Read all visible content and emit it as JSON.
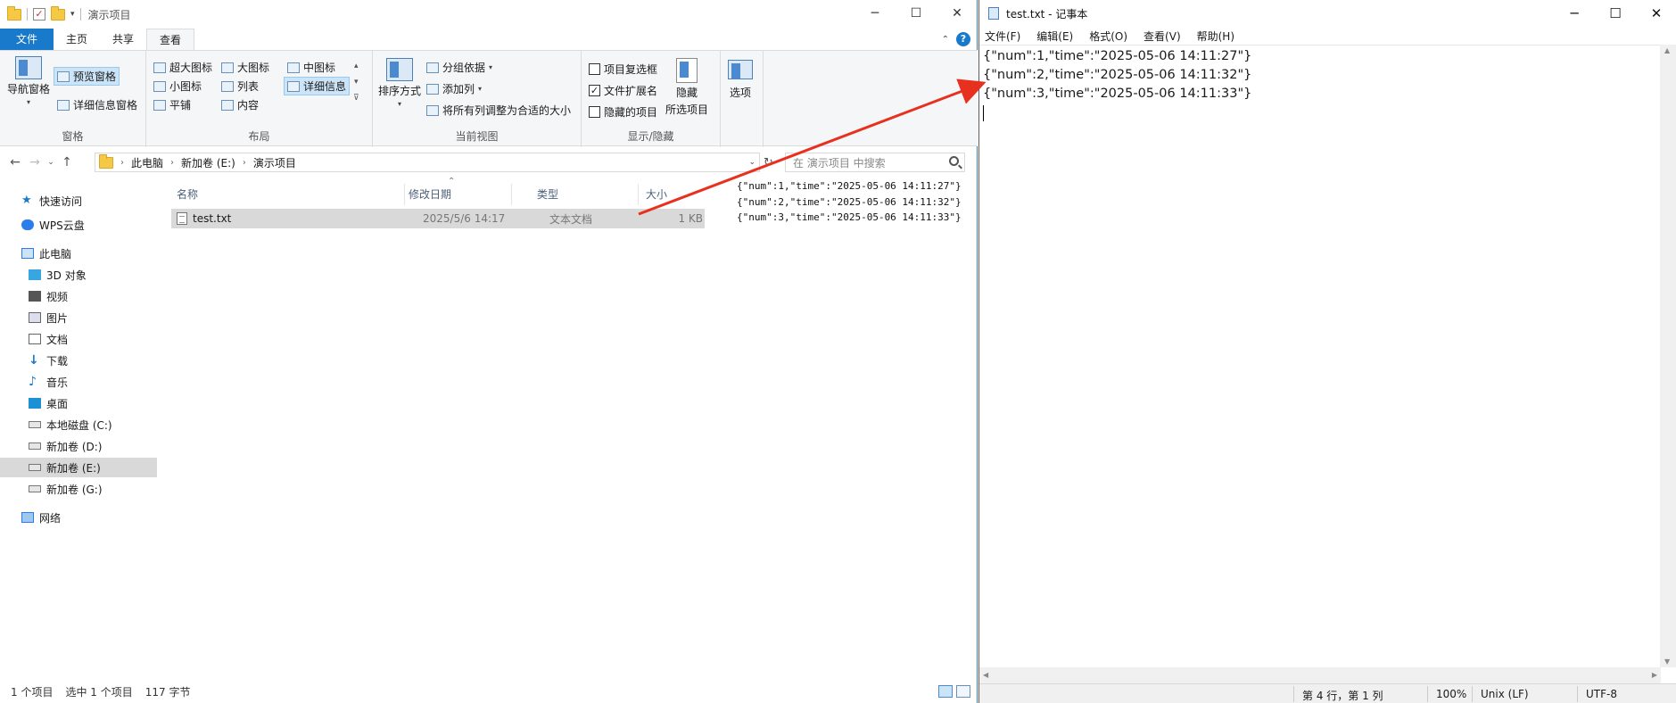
{
  "explorer": {
    "title": "演示项目",
    "tabs": [
      "文件",
      "主页",
      "共享",
      "查看"
    ],
    "active_tab": "查看",
    "ribbon": {
      "panes_group": {
        "nav_pane": "导航窗格",
        "preview_pane": "预览窗格",
        "details_pane": "详细信息窗格",
        "label": "窗格"
      },
      "layout_group": {
        "items": [
          "超大图标",
          "大图标",
          "中图标",
          "小图标",
          "列表",
          "详细信息",
          "平铺",
          "内容"
        ],
        "label": "布局"
      },
      "current_view_group": {
        "sort_by": "排序方式",
        "group_by": "分组依据",
        "add_columns": "添加列",
        "fit_columns": "将所有列调整为合适的大小",
        "label": "当前视图"
      },
      "show_hide_group": {
        "item_checkboxes": "项目复选框",
        "file_extensions": "文件扩展名",
        "hidden_items": "隐藏的项目",
        "hide_selected_1": "隐藏",
        "hide_selected_2": "所选项目",
        "label": "显示/隐藏"
      },
      "options": "选项"
    },
    "address": {
      "segments": [
        "此电脑",
        "新加卷 (E:)",
        "演示项目"
      ],
      "search_placeholder": "在 演示项目 中搜索"
    },
    "nav_pane": {
      "items": [
        "快速访问",
        "WPS云盘",
        "此电脑",
        "3D 对象",
        "视频",
        "图片",
        "文档",
        "下载",
        "音乐",
        "桌面",
        "本地磁盘 (C:)",
        "新加卷 (D:)",
        "新加卷 (E:)",
        "新加卷 (G:)",
        "网络"
      ],
      "selected": "新加卷 (E:)"
    },
    "columns": [
      "名称",
      "修改日期",
      "类型",
      "大小"
    ],
    "files": [
      {
        "name": "test.txt",
        "modified": "2025/5/6 14:17",
        "type": "文本文档",
        "size": "1 KB"
      }
    ],
    "preview_lines": [
      "{\"num\":1,\"time\":\"2025-05-06 14:11:27\"}",
      "{\"num\":2,\"time\":\"2025-05-06 14:11:32\"}",
      "{\"num\":3,\"time\":\"2025-05-06 14:11:33\"}"
    ],
    "status": {
      "item_count": "1 个项目",
      "selected": "选中 1 个项目",
      "size": "117 字节"
    }
  },
  "notepad": {
    "title": "test.txt - 记事本",
    "menu": [
      "文件(F)",
      "编辑(E)",
      "格式(O)",
      "查看(V)",
      "帮助(H)"
    ],
    "lines": [
      "{\"num\":1,\"time\":\"2025-05-06 14:11:27\"}",
      "{\"num\":2,\"time\":\"2025-05-06 14:11:32\"}",
      "{\"num\":3,\"time\":\"2025-05-06 14:11:33\"}"
    ],
    "status": {
      "position": "第 4 行，第 1 列",
      "zoom": "100%",
      "line_ending": "Unix (LF)",
      "encoding": "UTF-8"
    }
  },
  "colors": {
    "file_tab": "#1979ca",
    "arrow": "#e8301f",
    "selection": "#d9d9d9"
  }
}
